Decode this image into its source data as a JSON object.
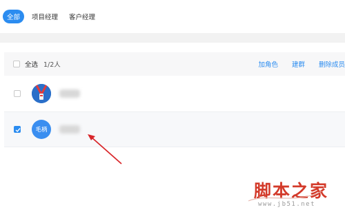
{
  "tabs": [
    {
      "label": "全部",
      "active": true
    },
    {
      "label": "项目经理",
      "active": false
    },
    {
      "label": "客户经理",
      "active": false
    }
  ],
  "list_header": {
    "select_all_label": "全选",
    "count": "1/2人",
    "actions": [
      "加角色",
      "建群",
      "删除成员"
    ]
  },
  "members": [
    {
      "checked": false,
      "avatar": "lanyard-image",
      "avatar_text": ""
    },
    {
      "checked": true,
      "avatar": "text",
      "avatar_text": "毛柄"
    }
  ],
  "annotation": {
    "arrow_color": "#d9262a"
  },
  "watermark": {
    "text": "脚本之家",
    "url": "www.jb51.net"
  },
  "colors": {
    "accent": "#2b8cf0",
    "watermark": "#d33a2a"
  }
}
